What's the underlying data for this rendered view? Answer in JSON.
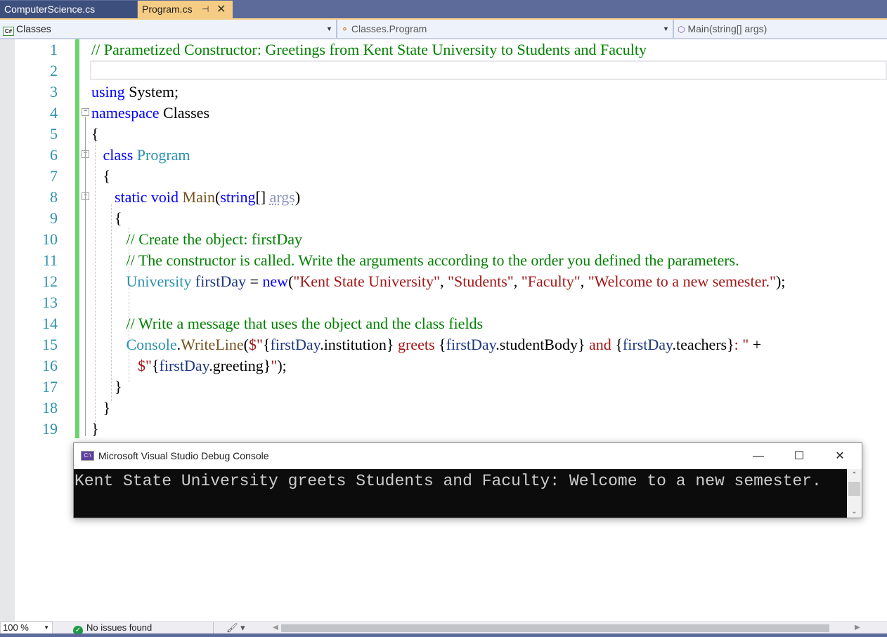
{
  "tabs": [
    {
      "label": "ComputerScience.cs",
      "active": false
    },
    {
      "label": "Program.cs",
      "active": true,
      "pin_icon": "pin-icon",
      "close_icon": "close-icon"
    }
  ],
  "navbar": {
    "project": "Classes",
    "project_icon": "C#",
    "type": "Classes.Program",
    "member": "Main(string[] args)"
  },
  "editor": {
    "line_numbers": [
      "1",
      "2",
      "3",
      "4",
      "5",
      "6",
      "7",
      "8",
      "9",
      "10",
      "11",
      "12",
      "13",
      "14",
      "15",
      "16",
      "17",
      "18",
      "19"
    ],
    "lines": [
      [
        {
          "c": "cm",
          "t": "// Parametized Constructor: Greetings from Kent State University to Students and Faculty"
        }
      ],
      [],
      [
        {
          "c": "kw",
          "t": "using"
        },
        {
          "c": "",
          "t": " System;"
        }
      ],
      [
        {
          "c": "kw",
          "t": "namespace"
        },
        {
          "c": "",
          "t": " Classes"
        }
      ],
      [
        {
          "c": "",
          "t": "{"
        }
      ],
      [
        {
          "c": "",
          "t": "   "
        },
        {
          "c": "kw",
          "t": "class"
        },
        {
          "c": "",
          "t": " "
        },
        {
          "c": "ty",
          "t": "Program"
        }
      ],
      [
        {
          "c": "",
          "t": "   {"
        }
      ],
      [
        {
          "c": "",
          "t": "      "
        },
        {
          "c": "kw",
          "t": "static void"
        },
        {
          "c": "",
          "t": " "
        },
        {
          "c": "mt",
          "t": "Main"
        },
        {
          "c": "",
          "t": "("
        },
        {
          "c": "kw",
          "t": "string"
        },
        {
          "c": "",
          "t": "[] "
        },
        {
          "c": "un",
          "t": "args"
        },
        {
          "c": "",
          "t": ")"
        }
      ],
      [
        {
          "c": "",
          "t": "      {"
        }
      ],
      [
        {
          "c": "",
          "t": "         "
        },
        {
          "c": "cm",
          "t": "// Create the object: firstDay"
        }
      ],
      [
        {
          "c": "",
          "t": "         "
        },
        {
          "c": "cm",
          "t": "// The constructor is called. Write the arguments according to the order you defined the parameters."
        }
      ],
      [
        {
          "c": "",
          "t": "         "
        },
        {
          "c": "ty",
          "t": "University"
        },
        {
          "c": "",
          "t": " "
        },
        {
          "c": "vr",
          "t": "firstDay"
        },
        {
          "c": "",
          "t": " = "
        },
        {
          "c": "kw",
          "t": "new"
        },
        {
          "c": "",
          "t": "("
        },
        {
          "c": "st",
          "t": "\"Kent State University\""
        },
        {
          "c": "",
          "t": ", "
        },
        {
          "c": "st",
          "t": "\"Students\""
        },
        {
          "c": "",
          "t": ", "
        },
        {
          "c": "st",
          "t": "\"Faculty\""
        },
        {
          "c": "",
          "t": ", "
        },
        {
          "c": "st",
          "t": "\"Welcome to a new semester.\""
        },
        {
          "c": "",
          "t": ");"
        }
      ],
      [],
      [
        {
          "c": "",
          "t": "         "
        },
        {
          "c": "cm",
          "t": "// Write a message that uses the object and the class fields"
        }
      ],
      [
        {
          "c": "",
          "t": "         "
        },
        {
          "c": "ty",
          "t": "Console"
        },
        {
          "c": "",
          "t": "."
        },
        {
          "c": "mt",
          "t": "WriteLine"
        },
        {
          "c": "",
          "t": "("
        },
        {
          "c": "st",
          "t": "$\""
        },
        {
          "c": "",
          "t": "{"
        },
        {
          "c": "vr",
          "t": "firstDay"
        },
        {
          "c": "",
          "t": ".institution} "
        },
        {
          "c": "st",
          "t": "greets"
        },
        {
          "c": "",
          "t": " {"
        },
        {
          "c": "vr",
          "t": "firstDay"
        },
        {
          "c": "",
          "t": ".studentBody} "
        },
        {
          "c": "st",
          "t": "and"
        },
        {
          "c": "",
          "t": " {"
        },
        {
          "c": "vr",
          "t": "firstDay"
        },
        {
          "c": "",
          "t": ".teachers}"
        },
        {
          "c": "st",
          "t": ": \""
        },
        {
          "c": "",
          "t": " +"
        }
      ],
      [
        {
          "c": "",
          "t": "            "
        },
        {
          "c": "st",
          "t": "$\""
        },
        {
          "c": "",
          "t": "{"
        },
        {
          "c": "vr",
          "t": "firstDay"
        },
        {
          "c": "",
          "t": ".greeting}"
        },
        {
          "c": "st",
          "t": "\""
        },
        {
          "c": "",
          "t": ");"
        }
      ],
      [
        {
          "c": "",
          "t": "      }"
        }
      ],
      [
        {
          "c": "",
          "t": "   }"
        }
      ],
      [
        {
          "c": "",
          "t": "}"
        }
      ]
    ]
  },
  "console": {
    "title": "Microsoft Visual Studio Debug Console",
    "icon_label": "C:\\",
    "output": "Kent State University greets Students and Faculty: Welcome to a new semester.",
    "minimize": "—",
    "maximize": "☐",
    "close": "✕"
  },
  "statusbar": {
    "zoom": "100 %",
    "issues": "No issues found"
  }
}
